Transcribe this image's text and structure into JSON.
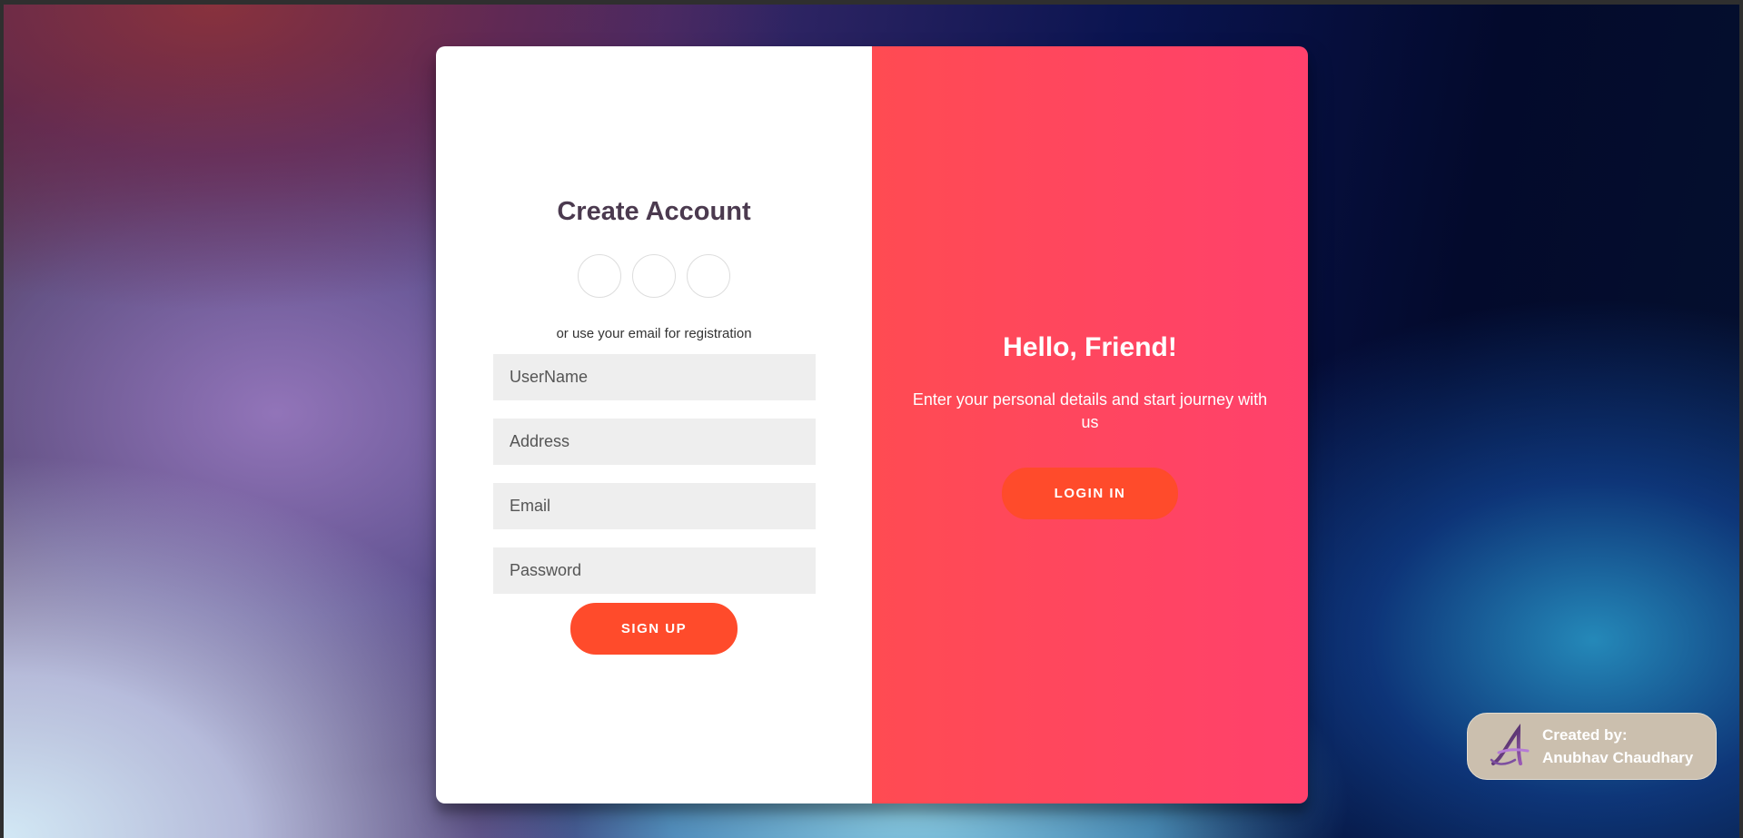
{
  "signup_panel": {
    "title": "Create Account",
    "subtext": "or use your email for registration",
    "username_placeholder": "UserName",
    "address_placeholder": "Address",
    "email_placeholder": "Email",
    "password_placeholder": "Password",
    "signup_label": "SIGN UP"
  },
  "overlay_panel": {
    "title": "Hello, Friend!",
    "text": "Enter your personal details and start journey with us",
    "login_label": "LOGIN IN"
  },
  "badge": {
    "line1": "Created by:",
    "line2": "Anubhav Chaudhary",
    "logo_letter": "A"
  },
  "colors": {
    "accent": "#ff4b2b",
    "overlay_start": "#ff4b52",
    "overlay_end": "#ff416c",
    "title": "#4b3a4f"
  }
}
